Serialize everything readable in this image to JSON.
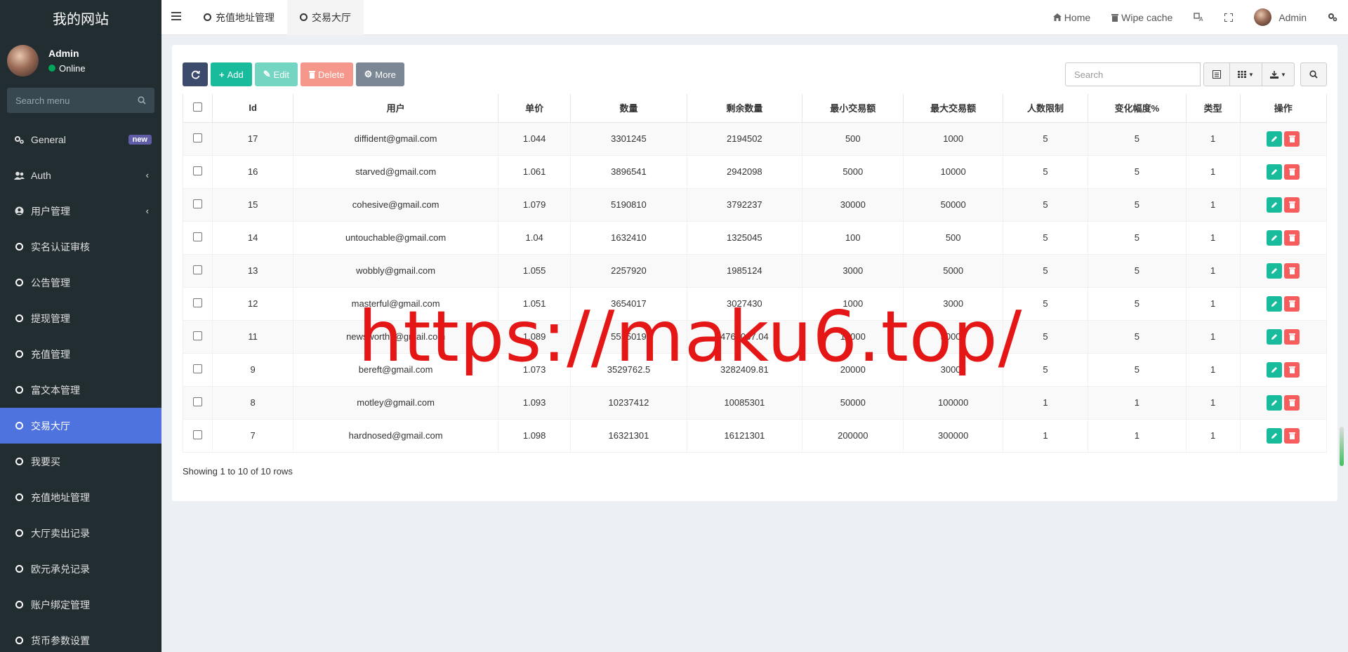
{
  "app": {
    "site_title": "我的网站",
    "user_name": "Admin",
    "user_status": "Online",
    "search_menu_placeholder": "Search menu"
  },
  "sidebar": {
    "items": [
      {
        "label": "General",
        "icon": "cogs-icon",
        "badge": "new"
      },
      {
        "label": "Auth",
        "icon": "users-icon",
        "chevron": true
      },
      {
        "label": "用户管理",
        "icon": "user-circle-icon",
        "chevron": true
      },
      {
        "label": "实名认证审核",
        "icon": "circle-icon"
      },
      {
        "label": "公告管理",
        "icon": "circle-icon"
      },
      {
        "label": "提现管理",
        "icon": "circle-icon"
      },
      {
        "label": "充值管理",
        "icon": "circle-icon"
      },
      {
        "label": "富文本管理",
        "icon": "circle-icon"
      },
      {
        "label": "交易大厅",
        "icon": "circle-icon",
        "active": true
      },
      {
        "label": "我要买",
        "icon": "circle-icon"
      },
      {
        "label": "充值地址管理",
        "icon": "circle-icon"
      },
      {
        "label": "大厅卖出记录",
        "icon": "circle-icon"
      },
      {
        "label": "欧元承兑记录",
        "icon": "circle-icon"
      },
      {
        "label": "账户绑定管理",
        "icon": "circle-icon"
      },
      {
        "label": "货币参数设置",
        "icon": "circle-icon"
      }
    ]
  },
  "topbar": {
    "tabs": [
      {
        "label": "充值地址管理",
        "active": false
      },
      {
        "label": "交易大厅",
        "active": true
      }
    ],
    "home_label": "Home",
    "wipe_cache_label": "Wipe cache",
    "admin_label": "Admin"
  },
  "toolbar": {
    "add_label": "Add",
    "edit_label": "Edit",
    "delete_label": "Delete",
    "more_label": "More",
    "search_placeholder": "Search"
  },
  "table": {
    "columns": [
      "Id",
      "用户",
      "单价",
      "数量",
      "剩余数量",
      "最小交易额",
      "最大交易额",
      "人数限制",
      "变化幅度%",
      "类型",
      "操作"
    ],
    "rows": [
      [
        "17",
        "diffident@gmail.com",
        "1.044",
        "3301245",
        "2194502",
        "500",
        "1000",
        "5",
        "5",
        "1"
      ],
      [
        "16",
        "starved@gmail.com",
        "1.061",
        "3896541",
        "2942098",
        "5000",
        "10000",
        "5",
        "5",
        "1"
      ],
      [
        "15",
        "cohesive@gmail.com",
        "1.079",
        "5190810",
        "3792237",
        "30000",
        "50000",
        "5",
        "5",
        "1"
      ],
      [
        "14",
        "untouchable@gmail.com",
        "1.04",
        "1632410",
        "1325045",
        "100",
        "500",
        "5",
        "5",
        "1"
      ],
      [
        "13",
        "wobbly@gmail.com",
        "1.055",
        "2257920",
        "1985124",
        "3000",
        "5000",
        "5",
        "5",
        "1"
      ],
      [
        "12",
        "masterful@gmail.com",
        "1.051",
        "3654017",
        "3027430",
        "1000",
        "3000",
        "5",
        "5",
        "1"
      ],
      [
        "11",
        "newsworthy@gmail.com",
        "1.089",
        "5555019",
        "4764037.04",
        "10000",
        "30000",
        "5",
        "5",
        "1"
      ],
      [
        "9",
        "bereft@gmail.com",
        "1.073",
        "3529762.5",
        "3282409.81",
        "20000",
        "30000",
        "5",
        "5",
        "1"
      ],
      [
        "8",
        "motley@gmail.com",
        "1.093",
        "10237412",
        "10085301",
        "50000",
        "100000",
        "1",
        "1",
        "1"
      ],
      [
        "7",
        "hardnosed@gmail.com",
        "1.098",
        "16321301",
        "16121301",
        "200000",
        "300000",
        "1",
        "1",
        "1"
      ]
    ]
  },
  "pager": {
    "info": "Showing 1 to 10 of 10 rows"
  },
  "watermark": "https://maku6.top/"
}
